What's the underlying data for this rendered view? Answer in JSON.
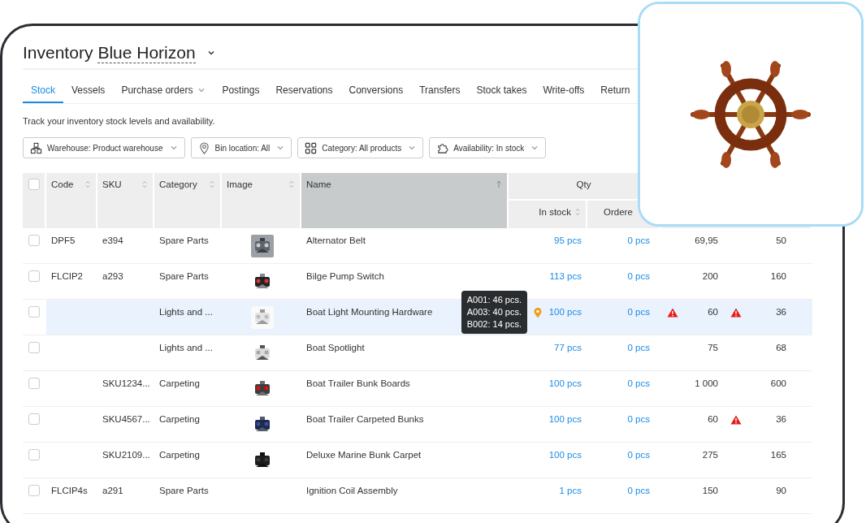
{
  "title": {
    "label": "Inventory",
    "warehouse": "Blue Horizon"
  },
  "tabs": [
    {
      "label": "Stock",
      "selected": true,
      "dropdown": false
    },
    {
      "label": "Vessels",
      "selected": false,
      "dropdown": false
    },
    {
      "label": "Purchase orders",
      "selected": false,
      "dropdown": true
    },
    {
      "label": "Postings",
      "selected": false,
      "dropdown": false
    },
    {
      "label": "Reservations",
      "selected": false,
      "dropdown": false
    },
    {
      "label": "Conversions",
      "selected": false,
      "dropdown": false
    },
    {
      "label": "Transfers",
      "selected": false,
      "dropdown": false
    },
    {
      "label": "Stock takes",
      "selected": false,
      "dropdown": false
    },
    {
      "label": "Write-offs",
      "selected": false,
      "dropdown": false
    },
    {
      "label": "Return",
      "selected": false,
      "dropdown": false
    }
  ],
  "description": "Track your inventory stock levels and availability.",
  "filters": [
    {
      "kind": "warehouse",
      "label": "Warehouse: Product warehouse"
    },
    {
      "kind": "location",
      "label": "Bin location: All"
    },
    {
      "kind": "category",
      "label": "Category: All products"
    },
    {
      "kind": "availability",
      "label": "Availability: In stock"
    }
  ],
  "table": {
    "select_all": {
      "checked": false
    },
    "columns": [
      {
        "label": "Code",
        "sortable": true,
        "sorted": false
      },
      {
        "label": "SKU",
        "sortable": true,
        "sorted": false
      },
      {
        "label": "Category",
        "sortable": true,
        "sorted": false
      },
      {
        "label": "Image",
        "sortable": true,
        "sorted": false
      },
      {
        "label": "Name",
        "sortable": true,
        "sorted": true
      }
    ],
    "group": {
      "label": "Qty",
      "columns": [
        {
          "label": "In stock",
          "sortable": true,
          "sorted": false
        },
        {
          "label": "Ordere"
        }
      ]
    },
    "rows": [
      {
        "checked": false,
        "highlighted": false,
        "code": "DPF5",
        "sku": "e394",
        "category": "Spare Parts",
        "image": {
          "kind": "picture"
        },
        "name": "Alternator Belt",
        "in_stock": "95 pcs",
        "ordered": "0 pcs",
        "column_3": "69,95",
        "column_3_warning": false,
        "column_4": "50",
        "column_4_warning": false
      },
      {
        "checked": false,
        "highlighted": false,
        "code": "FLCIP2",
        "sku": "a293",
        "category": "Spare Parts",
        "image": {
          "kind": "picture"
        },
        "name": "Bilge Pump Switch",
        "in_stock": "113 pcs",
        "ordered": "0 pcs",
        "column_3": "200",
        "column_3_warning": false,
        "column_4": "160",
        "column_4_warning": false
      },
      {
        "checked": false,
        "highlighted": true,
        "category": "Lights and ...",
        "image": {
          "kind": "picture"
        },
        "name": "Boat Light Mounting Hardware",
        "location_pin": true,
        "bin_tooltip": [
          "A001: 46 pcs.",
          "A003: 40 pcs.",
          "B002: 14 pcs."
        ],
        "in_stock": "100 pcs",
        "ordered": "0 pcs",
        "column_3": "60",
        "column_3_warning": true,
        "column_4": "36",
        "column_4_warning": true
      },
      {
        "checked": false,
        "highlighted": false,
        "category": "Lights and ...",
        "image": {
          "kind": "picture"
        },
        "name": "Boat Spotlight",
        "in_stock": "77 pcs",
        "ordered": "0 pcs",
        "column_3": "75",
        "column_3_warning": false,
        "column_4": "68",
        "column_4_warning": false
      },
      {
        "checked": false,
        "highlighted": false,
        "sku": "SKU1234...",
        "category": "Carpeting",
        "image": {
          "kind": "picture"
        },
        "name": "Boat Trailer Bunk Boards",
        "in_stock": "100 pcs",
        "ordered": "0 pcs",
        "column_3": "1 000",
        "column_3_warning": false,
        "column_4": "600",
        "column_4_warning": false
      },
      {
        "checked": false,
        "highlighted": false,
        "sku": "SKU4567...",
        "category": "Carpeting",
        "image": {
          "kind": "picture"
        },
        "name": "Boat Trailer Carpeted Bunks",
        "in_stock": "100 pcs",
        "ordered": "0 pcs",
        "column_3": "60",
        "column_3_warning": false,
        "column_4": "36",
        "column_4_warning": true
      },
      {
        "checked": false,
        "highlighted": false,
        "sku": "SKU2109...",
        "category": "Carpeting",
        "image": {
          "kind": "picture"
        },
        "name": "Deluxe Marine Bunk Carpet",
        "in_stock": "100 pcs",
        "ordered": "0 pcs",
        "column_3": "275",
        "column_3_warning": false,
        "column_4": "165",
        "column_4_warning": false
      },
      {
        "checked": false,
        "highlighted": false,
        "code": "FLCIP4s",
        "sku": "a291",
        "category": "Spare Parts",
        "name": "Ignition Coil Assembly",
        "in_stock": "1 pcs",
        "ordered": "0 pcs",
        "column_3": "150",
        "column_3_warning": false,
        "column_4": "90",
        "column_4_warning": false
      }
    ]
  },
  "preview": {
    "kind": "picture"
  }
}
